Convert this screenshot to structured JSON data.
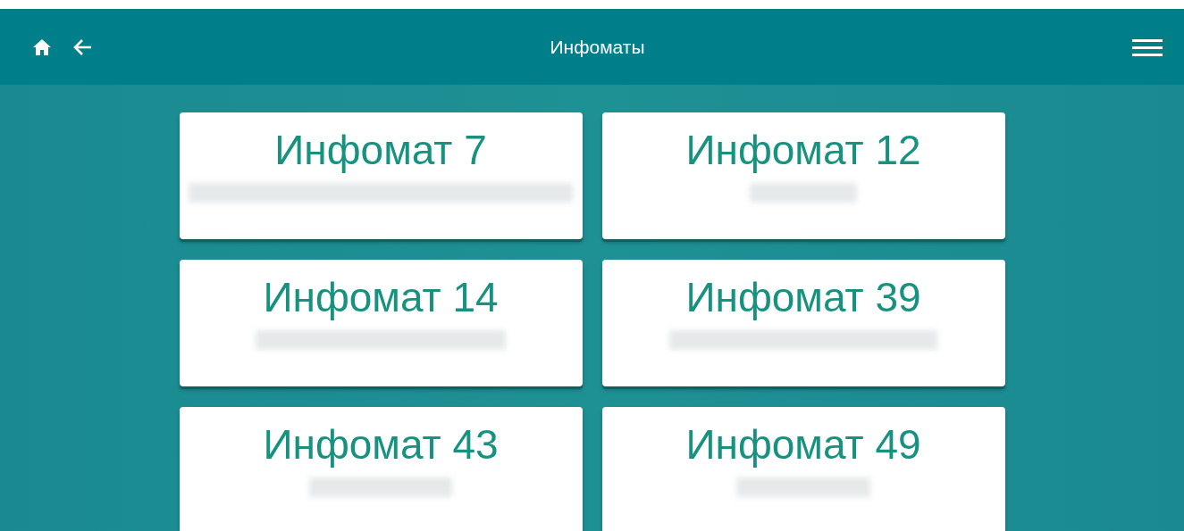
{
  "header": {
    "title": "Инфоматы"
  },
  "cards": [
    {
      "title": "Инфомат 7"
    },
    {
      "title": "Инфомат 12"
    },
    {
      "title": "Инфомат 14"
    },
    {
      "title": "Инфомат 39"
    },
    {
      "title": "Инфомат 43"
    },
    {
      "title": "Инфомат 49"
    }
  ]
}
